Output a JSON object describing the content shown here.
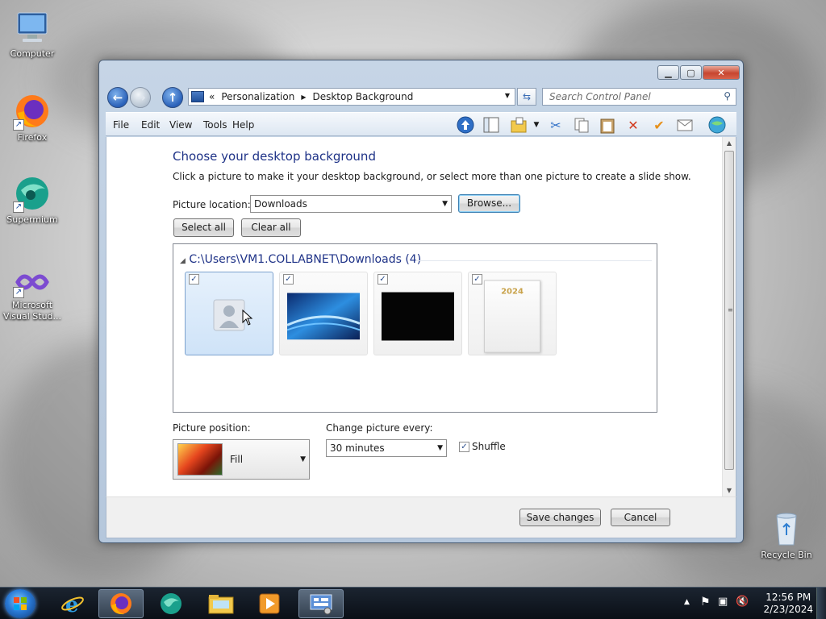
{
  "desktop": {
    "icons": [
      {
        "label": "Computer"
      },
      {
        "label": "Firefox"
      },
      {
        "label": "Supermium"
      },
      {
        "label": "Microsoft Visual Stud..."
      },
      {
        "label": "Recycle Bin"
      }
    ]
  },
  "window": {
    "breadcrumb": {
      "prefix": "«",
      "items": [
        "Personalization",
        "Desktop Background"
      ]
    },
    "search_placeholder": "Search Control Panel",
    "menu": [
      "File",
      "Edit",
      "View",
      "Tools",
      "Help"
    ],
    "heading": "Choose your desktop background",
    "intro": "Click a picture to make it your desktop background, or select more than one picture to create a slide show.",
    "picture_location": {
      "label": "Picture location:",
      "value": "Downloads",
      "browse": "Browse..."
    },
    "select_all": "Select all",
    "clear_all": "Clear all",
    "folder_header": "C:\\Users\\VM1.COLLABNET\\Downloads (4)",
    "tiles": [
      {
        "kind": "user-icon",
        "checked": true,
        "selected": true
      },
      {
        "kind": "blue-abstract",
        "checked": true,
        "selected": false
      },
      {
        "kind": "black",
        "checked": true,
        "selected": false
      },
      {
        "kind": "calendar-2024",
        "checked": true,
        "selected": false,
        "caption": "2024"
      }
    ],
    "picture_position": {
      "label": "Picture position:",
      "value": "Fill"
    },
    "change_every": {
      "label": "Change picture every:",
      "value": "30 minutes"
    },
    "shuffle": {
      "label": "Shuffle",
      "checked": true
    },
    "save": "Save changes",
    "cancel": "Cancel"
  },
  "taskbar": {
    "apps": [
      "internet-explorer",
      "firefox",
      "supermium",
      "file-explorer",
      "media-player",
      "control-panel"
    ],
    "time": "12:56 PM",
    "date": "2/23/2024"
  },
  "colors": {
    "heading": "#1e3287",
    "selected_tile": "#cfe3f8",
    "taskbar": "#0a0f16"
  }
}
